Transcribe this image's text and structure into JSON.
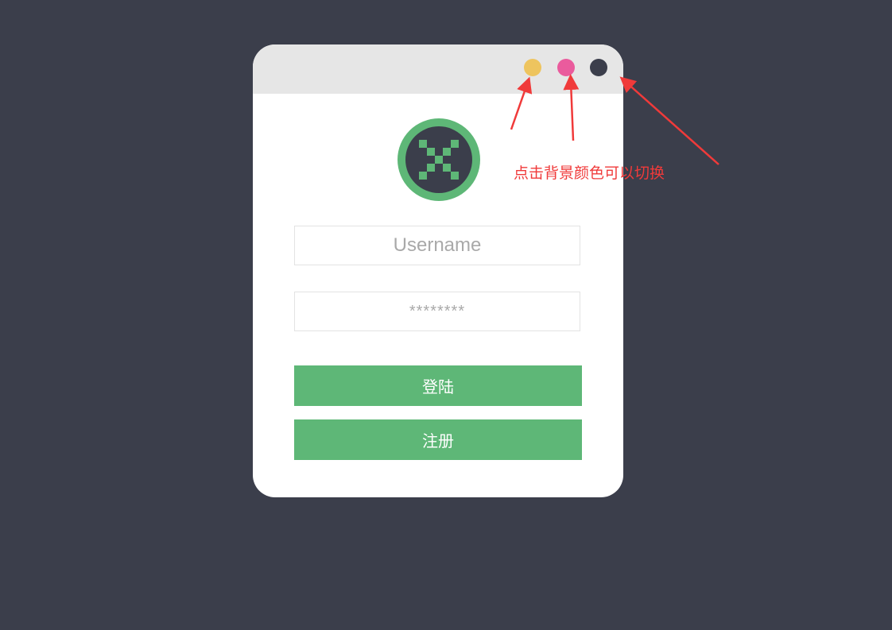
{
  "colors": {
    "page_background": "#3b3e4b",
    "card_background": "#ffffff",
    "titlebar_background": "#e6e6e6",
    "accent_green": "#5eb777",
    "annotation_red": "#f03a3a",
    "theme_dots": [
      "#eec45e",
      "#ea5b9d",
      "#3b3e4b"
    ]
  },
  "titlebar": {
    "theme_dots": [
      {
        "name": "yellow-theme-dot",
        "color": "#eec45e"
      },
      {
        "name": "pink-theme-dot",
        "color": "#ea5b9d"
      },
      {
        "name": "dark-theme-dot",
        "color": "#3b3e4b"
      }
    ]
  },
  "logo": {
    "icon": "x-logo-icon"
  },
  "form": {
    "username_placeholder": "Username",
    "password_placeholder": "********",
    "login_label": "登陆",
    "register_label": "注册"
  },
  "annotation": {
    "text": "点击背景颜色可以切换",
    "icon": "arrow-icon"
  }
}
